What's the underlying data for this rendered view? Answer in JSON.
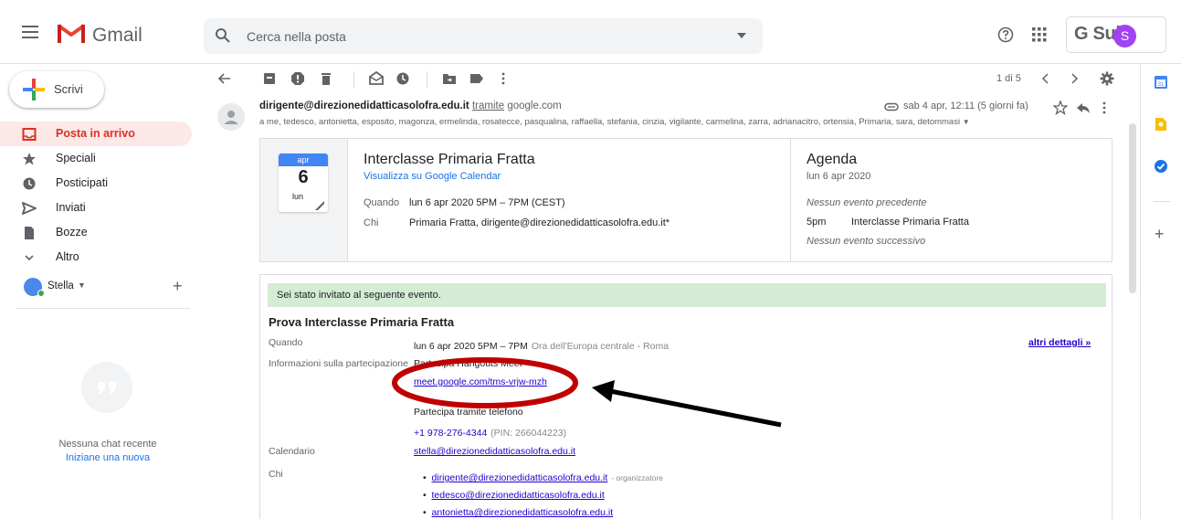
{
  "header": {
    "app_name": "Gmail",
    "search_placeholder": "Cerca nella posta",
    "gsuite_label": "G Suite",
    "avatar_letter": "S"
  },
  "sidebar": {
    "compose_label": "Scrivi",
    "items": [
      {
        "label": "Posta in arrivo",
        "icon": "inbox-icon",
        "active": true
      },
      {
        "label": "Speciali",
        "icon": "star-icon"
      },
      {
        "label": "Posticipati",
        "icon": "clock-icon"
      },
      {
        "label": "Inviati",
        "icon": "send-icon"
      },
      {
        "label": "Bozze",
        "icon": "draft-icon"
      },
      {
        "label": "Altro",
        "icon": "chevron-down-icon"
      }
    ],
    "user_name": "Stella",
    "chat_empty": "Nessuna chat recente",
    "chat_new": "Iniziane una nuova"
  },
  "toolbar": {
    "pager": "1 di 5"
  },
  "message": {
    "sender": "dirigente@direzionedidatticasolofra.edu.it",
    "via_word": "tramite",
    "via_domain": "google.com",
    "date": "sab 4 apr, 12:11 (5 giorni fa)",
    "recipients": "a me, tedesco, antonietta, esposito, magonza, ermelinda, rosatecce, pasqualina, raffaella, stefania, cinzia, vigilante, carmelina, zarra, adrianacitro, ortensia, Primaria, sara, detommasi"
  },
  "event_card": {
    "month": "apr",
    "day": "6",
    "weekday": "lun",
    "title": "Interclasse Primaria Fratta",
    "gcal_link": "Visualizza su Google Calendar",
    "when_label": "Quando",
    "when_value": "lun 6 apr 2020 5PM – 7PM (CEST)",
    "who_label": "Chi",
    "who_value": "Primaria Fratta, dirigente@direzionedidatticasolofra.edu.it*",
    "agenda_title": "Agenda",
    "agenda_date": "lun 6 apr 2020",
    "agenda_prev": "Nessun evento precedente",
    "agenda_time": "5pm",
    "agenda_event": "Interclasse Primaria Fratta",
    "agenda_next": "Nessun evento successivo"
  },
  "invite": {
    "banner": "Sei stato invitato al seguente evento.",
    "title": "Prova Interclasse Primaria Fratta",
    "when_label": "Quando",
    "when_value": "lun 6 apr 2020 5PM – 7PM",
    "when_tz": "Ora dell'Europa centrale - Roma",
    "more_details": "altri dettagli »",
    "join_label": "Informazioni sulla partecipazione",
    "hangouts_label": "Partecipa Hangouts Meet",
    "meet_link": "meet.google.com/tms-vrjw-mzh",
    "phone_label": "Partecipa tramite telefono",
    "phone_number": "+1 978-276-4344",
    "phone_pin": "(PIN: 266044223)",
    "calendar_label": "Calendario",
    "calendar_value": "stella@direzionedidatticasolofra.edu.it",
    "who_label": "Chi",
    "attendees": [
      {
        "email": "dirigente@direzionedidatticasolofra.edu.it",
        "role": "- organizzatore"
      },
      {
        "email": "tedesco@direzionedidatticasolofra.edu.it",
        "role": ""
      },
      {
        "email": "antonietta@direzionedidatticasolofra.edu.it",
        "role": ""
      }
    ]
  },
  "colors": {
    "gmail_red": "#ea4335",
    "link_blue": "#1a73e8",
    "annotation_red": "#c00000",
    "banner_green": "#d4ecd4"
  }
}
